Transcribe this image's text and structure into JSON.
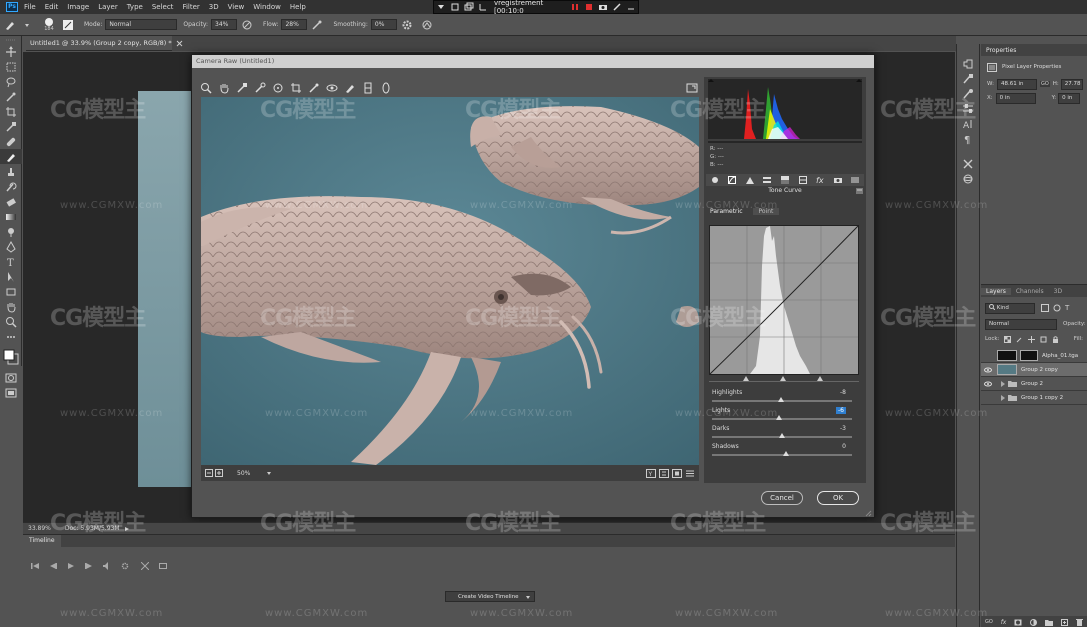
{
  "menubar": {
    "logo": "Ps",
    "items": [
      "File",
      "Edit",
      "Image",
      "Layer",
      "Type",
      "Select",
      "Filter",
      "3D",
      "View",
      "Window",
      "Help"
    ]
  },
  "recorder": {
    "label": "vregistrement [00:10:0"
  },
  "options": {
    "brush_size": "184",
    "mode_label": "Mode:",
    "mode_value": "Normal",
    "opacity_label": "Opacity:",
    "opacity_value": "34%",
    "flow_label": "Flow:",
    "flow_value": "28%",
    "smoothing_label": "Smoothing:",
    "smoothing_value": "0%"
  },
  "document": {
    "tab_title": "Untitled1 @ 33.9% (Group 2 copy, RGB/8) *",
    "zoom_status": "33.89%",
    "doc_status": "Doc: 5.93M/5.93M"
  },
  "camera_raw": {
    "title": "Camera Raw (Untitled1)",
    "zoom": "50%",
    "rgb": {
      "r": "R:",
      "g": "G:",
      "b": "B:",
      "dash": "---"
    },
    "panel_title": "Tone Curve",
    "tabs": [
      "Parametric",
      "Point"
    ],
    "sliders": [
      {
        "label": "Highlights",
        "value": "-8",
        "pos": 0.49
      },
      {
        "label": "Lights",
        "value": "-6",
        "pos": 0.48
      },
      {
        "label": "Darks",
        "value": "-3",
        "pos": 0.5
      },
      {
        "label": "Shadows",
        "value": "0",
        "pos": 0.53
      }
    ],
    "cancel_label": "Cancel",
    "ok_label": "OK"
  },
  "properties": {
    "title": "Properties",
    "subtitle": "Pixel Layer Properties",
    "w_label": "W:",
    "w_value": "48.61 in",
    "h_label": "H:",
    "h_value": "27.78",
    "x_label": "X:",
    "x_value": "0 in",
    "y_label": "Y:",
    "y_value": "0 in",
    "go_label": "GO"
  },
  "layers": {
    "tabs": [
      "Layers",
      "Channels",
      "3D"
    ],
    "kind_label": "Kind",
    "blend_mode": "Normal",
    "opacity_label": "Opacity:",
    "lock_label": "Lock:",
    "fill_label": "Fill:",
    "items": [
      {
        "name": "Alpha_01.tga",
        "visible": false,
        "type": "pixel"
      },
      {
        "name": "Group 2 copy",
        "visible": true,
        "type": "pixel"
      },
      {
        "name": "Group 2",
        "visible": true,
        "type": "group"
      },
      {
        "name": "Group 1 copy 2",
        "visible": false,
        "type": "group"
      }
    ]
  },
  "timeline": {
    "title": "Timeline",
    "create_label": "Create Video Timeline"
  },
  "watermark": {
    "brand": "CG模型主",
    "url": "www.CGMXW.com"
  },
  "colors": {
    "accent": "#31a8ff",
    "record": "#e02f2f",
    "preview_bg": "#44717f"
  }
}
